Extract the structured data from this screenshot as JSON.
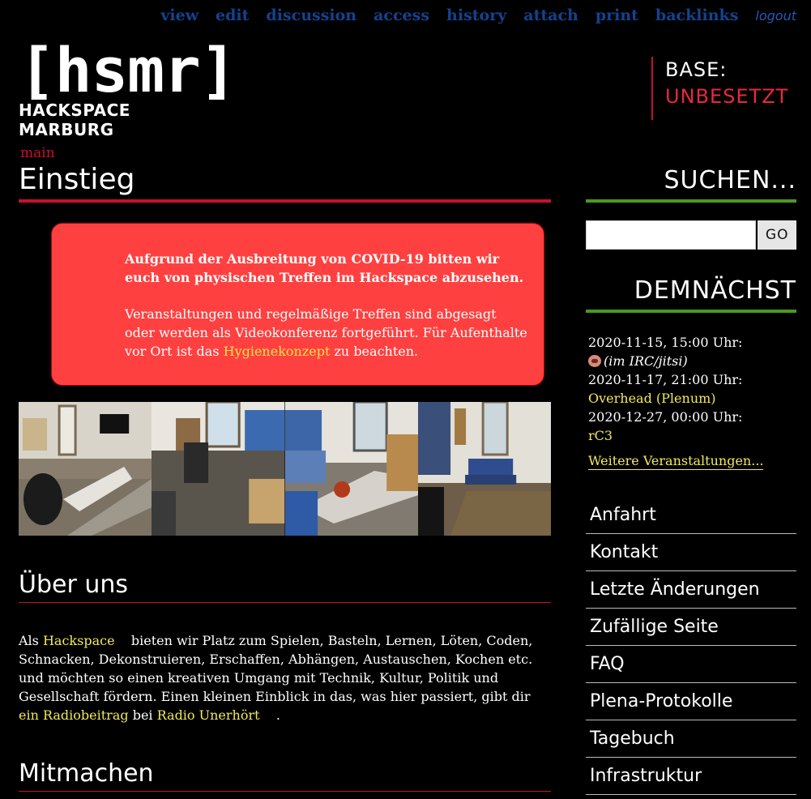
{
  "topnav": {
    "items": [
      "view",
      "edit",
      "discussion",
      "access",
      "history",
      "attach",
      "print",
      "backlinks"
    ],
    "logout": "logout"
  },
  "logo": {
    "mark": "[hsmr]",
    "subtitle": "HACKSPACE MARBURG"
  },
  "base": {
    "label": "BASE:",
    "status": "UNBESETZT"
  },
  "breadcrumb": "main",
  "page_title": "Einstieg",
  "notice": {
    "bold": "Aufgrund der Ausbreitung von COVID-19 bitten wir euch von physischen Treffen im Hackspace abzusehen.",
    "text1": "Veranstaltungen und regelmäßige Treffen sind abgesagt oder werden als Videokonferenz fortgeführt. Für Aufenthalte vor Ort ist das ",
    "link": "Hygienekonzept",
    "text2": " zu beachten."
  },
  "sections": {
    "about_title": "Über uns",
    "join_title": "Mitmachen"
  },
  "about": {
    "t1": "Als ",
    "link1": "Hackspace",
    "t2": "    bieten wir Platz zum Spielen, Basteln, Lernen, Löten, Coden, Schnacken, Dekonstruieren, Erschaffen, Abhängen, Austauschen, Kochen etc. und möchten so einen kreativen Umgang mit Technik, Kultur, Politik und Gesellschaft fördern. Einen kleinen Einblick in das, was hier passiert, gibt dir ",
    "link2": "ein Radiobeitrag",
    "t3": " bei ",
    "link3": "Radio Unerhört",
    "t4": "    ."
  },
  "search": {
    "title": "SUCHEN...",
    "value": "",
    "button": "GO"
  },
  "events": {
    "title": "DEMNÄCHST",
    "e1_time": "2020-11-15, 15:00 Uhr:",
    "e1_note": "(im IRC/jitsi)",
    "e2_time": "2020-11-17, 21:00 Uhr:",
    "e2_link": "Overhead (Plenum)",
    "e3_time": "2020-12-27, 00:00 Uhr:",
    "e3_link": "rC3",
    "more": "Weitere Veranstaltungen..."
  },
  "menu": [
    "Anfahrt",
    "Kontakt",
    "Letzte Änderungen",
    "Zufällige Seite",
    "FAQ",
    "Plena-Protokolle",
    "Tagebuch",
    "Infrastruktur"
  ],
  "colors": {
    "accent_red": "#c8102e",
    "accent_green": "#4b9a1e",
    "link_yellow": "#f2e85c",
    "nav_blue": "#14428f"
  }
}
